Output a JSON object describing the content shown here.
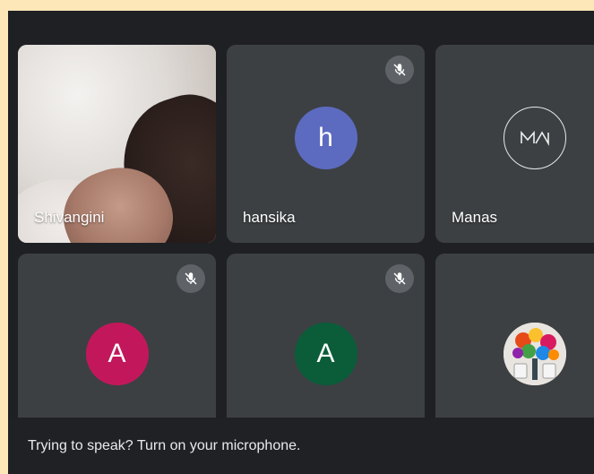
{
  "participants": [
    {
      "name": "Shivangini",
      "type": "video"
    },
    {
      "name": "hansika",
      "initial": "h",
      "avatar_color": "#5c6bc0",
      "muted": true
    },
    {
      "name": "Manas",
      "initial": "MN",
      "type": "logo"
    },
    {
      "name": "",
      "initial": "A",
      "avatar_color": "#c2185b",
      "muted": true
    },
    {
      "name": "",
      "initial": "A",
      "avatar_color": "#0b5d3a",
      "muted": true
    },
    {
      "name": "",
      "type": "photo"
    }
  ],
  "icons": {
    "mute": "mic-off-icon"
  },
  "banner": {
    "text": "Trying to speak? Turn on your microphone."
  },
  "colors": {
    "background": "#1f2023",
    "tile": "#3c4043",
    "mute_badge": "#5f6368"
  }
}
